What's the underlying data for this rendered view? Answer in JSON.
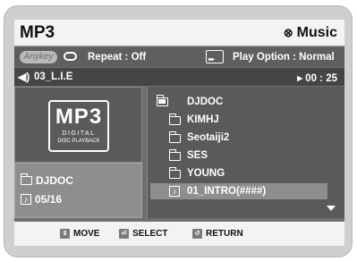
{
  "header": {
    "title": "MP3",
    "mode_icon": "disc-icon",
    "mode_label": "Music"
  },
  "options": {
    "anykey_label": "Anykey",
    "repeat_label": "Repeat : Off",
    "play_option_label": "Play Option : Normal",
    "play_option_icon_text": "▸▸▸"
  },
  "track": {
    "name": "03_L.I.E",
    "time": "▸ 00 : 25"
  },
  "logo": {
    "main": "MP3",
    "sub1": "DIGITAL",
    "sub2": "DISC PLAYBACK"
  },
  "info": {
    "folder": "DJDOC",
    "track_count": "05/16"
  },
  "file_list": {
    "items": [
      {
        "label": "DJDOC",
        "icon": "open-folder-icon"
      },
      {
        "label": "KIMHJ",
        "icon": "folder-icon"
      },
      {
        "label": "Seotaiji2",
        "icon": "folder-icon"
      },
      {
        "label": "SES",
        "icon": "folder-icon"
      },
      {
        "label": "YOUNG",
        "icon": "folder-icon"
      },
      {
        "label": "01_INTRO(####)",
        "icon": "music-note-icon",
        "selected": true
      }
    ]
  },
  "footer": {
    "move": "MOVE",
    "select": "SELECT",
    "return": "RETURN",
    "move_key": "⇕",
    "select_key": "⏎",
    "return_key": "↺"
  },
  "colors": {
    "screen_bg": "#6e6e6e",
    "bar_light": "#f3f3f3",
    "selected_row": "#8e8e8e"
  }
}
